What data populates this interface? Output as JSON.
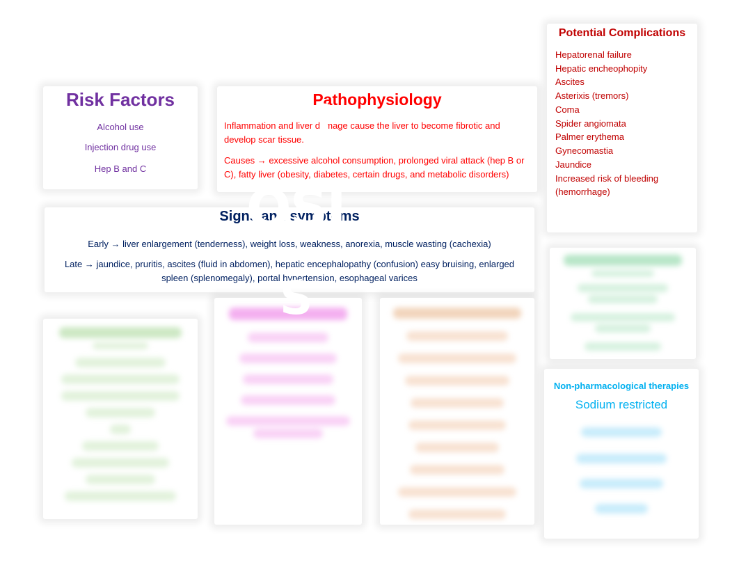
{
  "risk_factors": {
    "title": "Risk Factors",
    "items": [
      "Alcohol use",
      "Injection drug use",
      "Hep B and C"
    ]
  },
  "pathophysiology": {
    "title": "Pathophysiology",
    "paragraph1": "Inflammation and liver damage cause the liver to become fibrotic and develop scar tissue.",
    "causes_label": "Causes",
    "causes_text": " excessive alcohol consumption, prolonged viral attack (hep B or C), fatty liver (obesity, diabetes, certain drugs, and metabolic disorders)"
  },
  "signs_and_symptoms": {
    "title": "Signs and symptoms",
    "early_label": "Early",
    "early_text": " liver enlargement (tenderness), weight loss, weakness, anorexia, muscle wasting (cachexia)",
    "late_label": "Late",
    "late_text": " jaundice, pruritis, ascites (fluid in abdomen), hepatic encephalopathy (confusion) easy bruising, enlarged spleen (splenomegaly), portal hypertension, esophageal varices"
  },
  "potential_complications": {
    "title": "Potential Complications",
    "items": [
      "Hepatorenal failure",
      "Hepatic encheophopity",
      "Ascites",
      "Asterixis (tremors)",
      "Coma",
      "Spider angiomata",
      "Palmer erythema",
      "Gynecomastia",
      "Jaundice",
      "Increased risk of bleeding (hemorrhage)"
    ]
  },
  "non_pharmacological_therapies": {
    "title": "Non-pharmacological therapies",
    "first_item": "Sodium restricted"
  },
  "overlay": {
    "letters": [
      "I",
      "OSI",
      "S"
    ]
  },
  "arrow_glyph": "→",
  "colors": {
    "risk": "#7030a0",
    "patho": "#ff0000",
    "signs": "#002060",
    "complications": "#c00000",
    "nonpharm": "#00b0f0",
    "green_blur": "#b8e6c8",
    "pink_blur": "#f4a6f0",
    "orange_blur": "#f2cfb0",
    "lab_green_blur": "#cde8c4"
  }
}
